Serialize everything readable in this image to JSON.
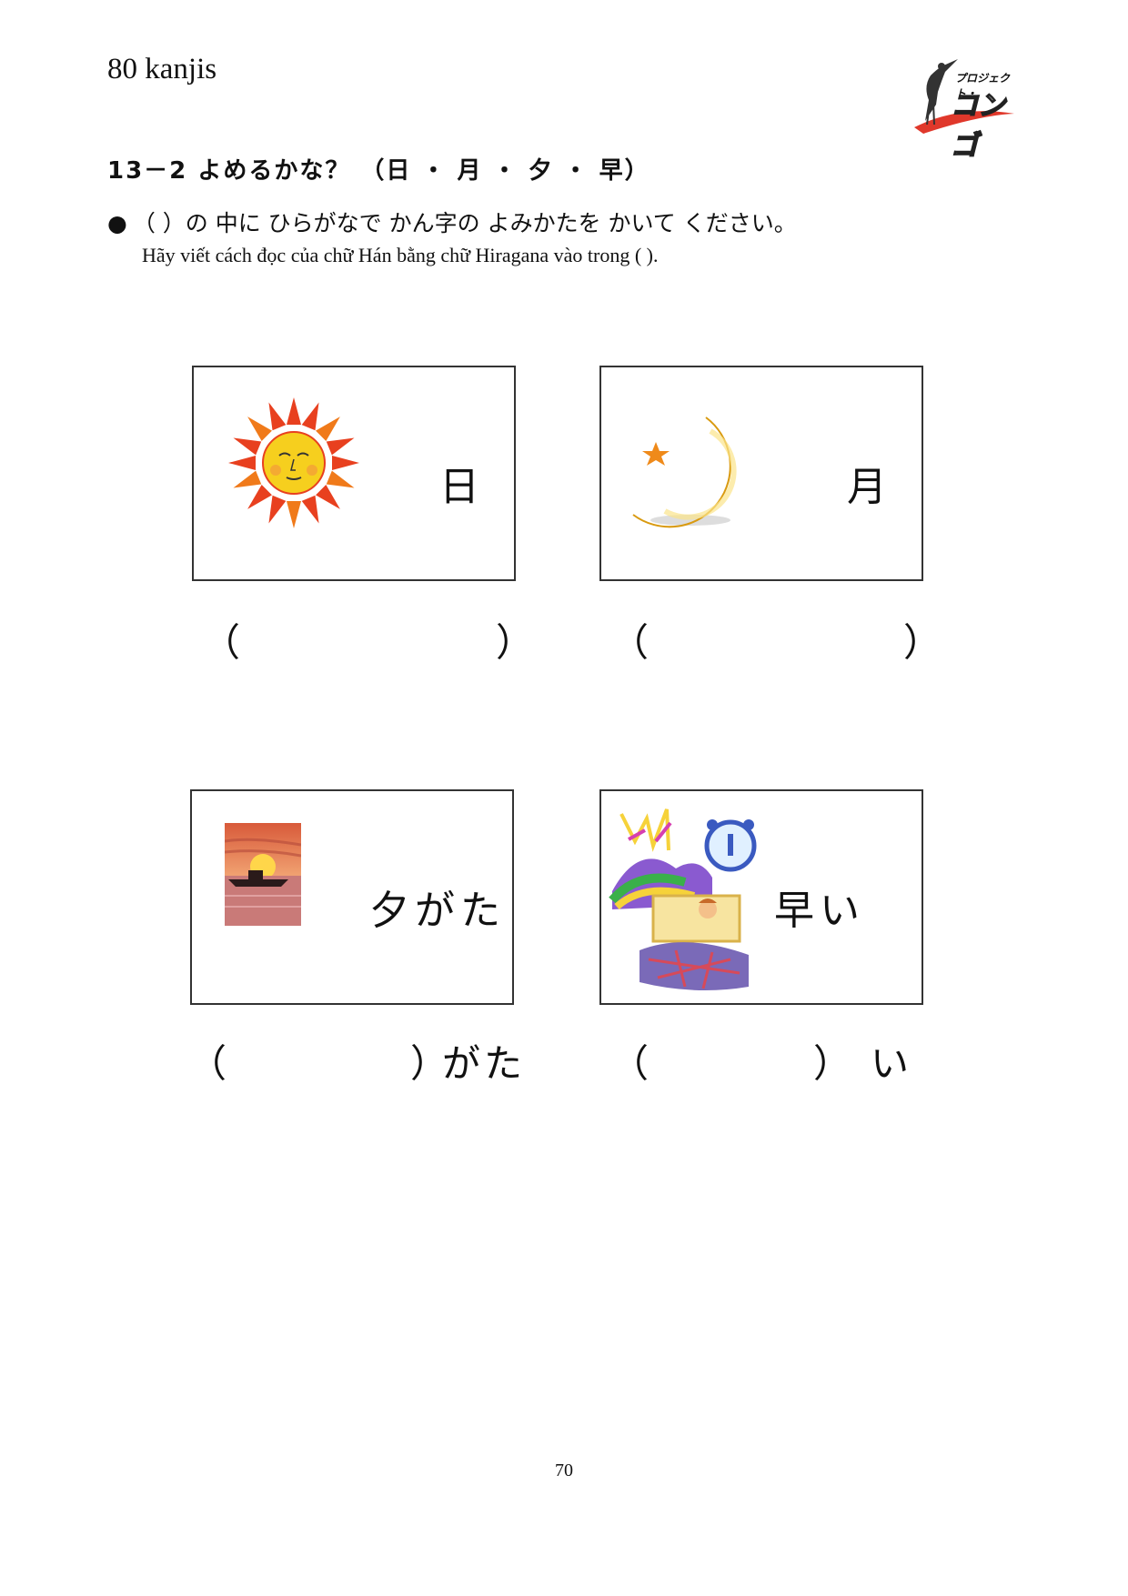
{
  "header": {
    "book_title": "80 kanjis",
    "logo_text_top": "プロジェクト・",
    "logo_text_main": "コンゴ"
  },
  "section": {
    "heading": "13－2 よめるかな？ （日 ・ 月 ・ 夕 ・ 早）"
  },
  "instruction": {
    "bullet": "●",
    "japanese": "（ ）の 中に ひらがなで かん字の よみかたを かいて ください。",
    "vietnamese": "Hãy viết cách đọc của chữ Hán bằng chữ Hiragana vào trong ( )."
  },
  "cards": [
    {
      "word": "日",
      "icon": "sun-icon",
      "answer_open": "（",
      "answer_close": "）",
      "answer_suffix": ""
    },
    {
      "word": "月",
      "icon": "moon-icon",
      "answer_open": "（",
      "answer_close": "）",
      "answer_suffix": ""
    },
    {
      "word": "夕がた",
      "icon": "sunset-icon",
      "answer_open": "（",
      "answer_close": "）",
      "answer_suffix": "がた"
    },
    {
      "word": "早い",
      "icon": "wake-up-icon",
      "answer_open": "（",
      "answer_close": "）",
      "answer_suffix": "い"
    }
  ],
  "footer": {
    "page_number": "70"
  },
  "colors": {
    "sun_ray": "#e8401f",
    "sun_face": "#f6cf1e",
    "moon": "#f5c21b",
    "star": "#ef8a1a",
    "border": "#333333"
  }
}
